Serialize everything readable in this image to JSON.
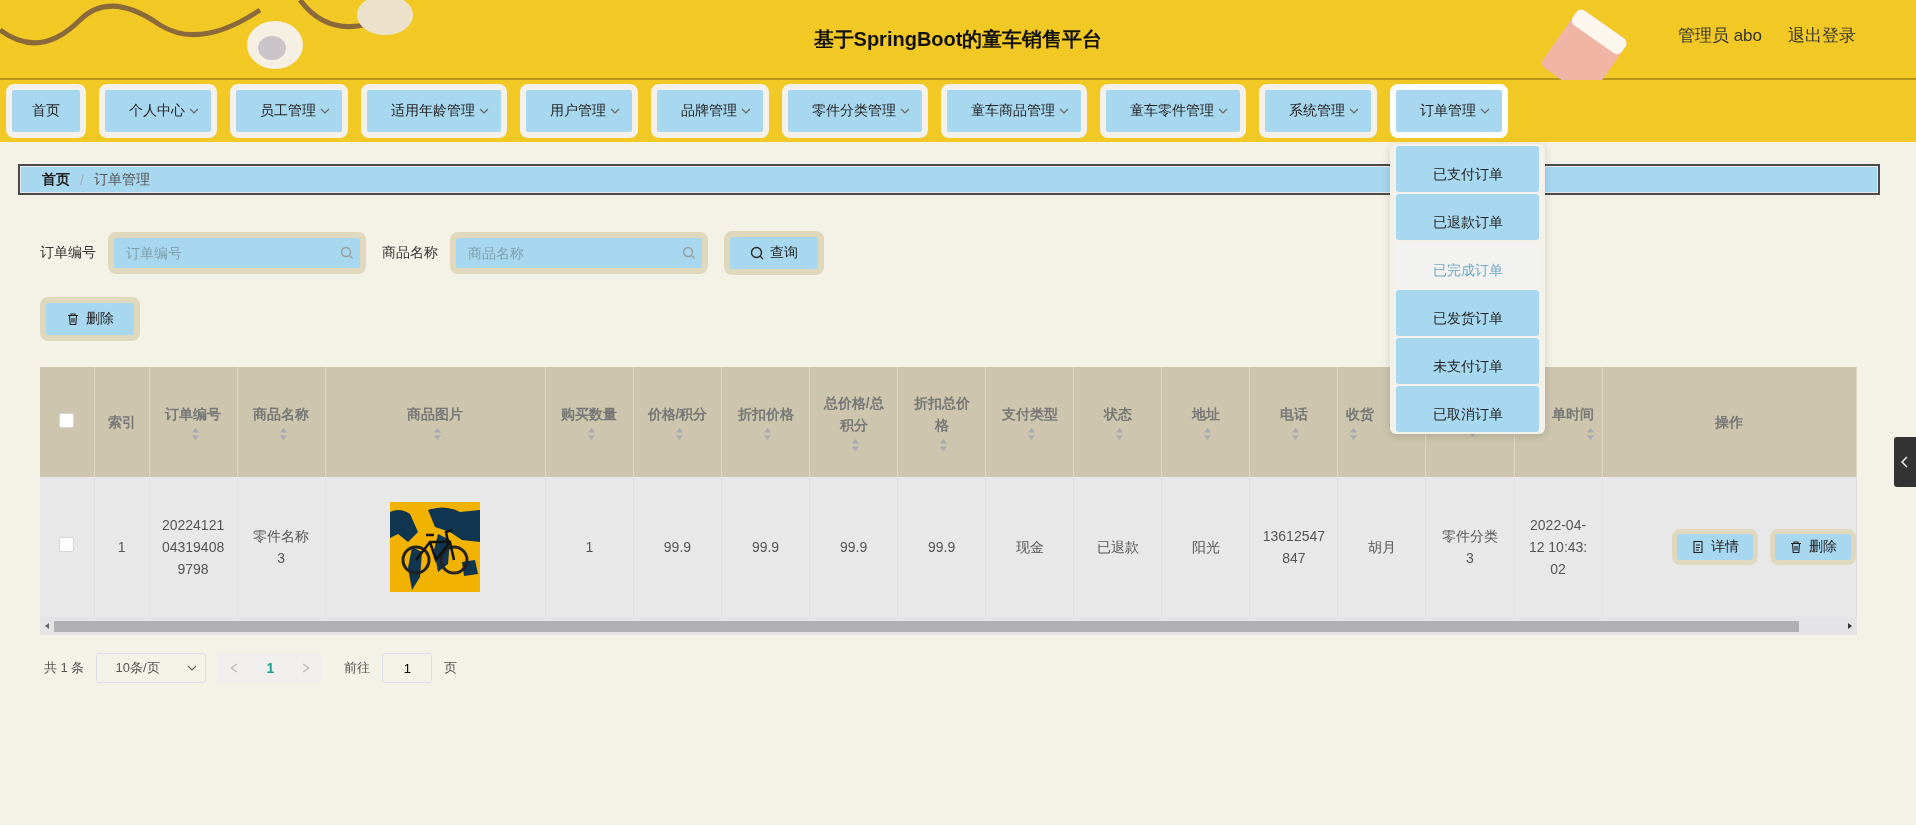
{
  "header": {
    "title": "基于SpringBoot的童车销售平台",
    "user": "管理员 abo",
    "logout": "退出登录"
  },
  "nav": [
    {
      "label": "首页",
      "has_menu": false,
      "expanded": false
    },
    {
      "label": "个人中心",
      "has_menu": true,
      "expanded": false
    },
    {
      "label": "员工管理",
      "has_menu": true,
      "expanded": false
    },
    {
      "label": "适用年龄管理",
      "has_menu": true,
      "expanded": false
    },
    {
      "label": "用户管理",
      "has_menu": true,
      "expanded": false
    },
    {
      "label": "品牌管理",
      "has_menu": true,
      "expanded": false
    },
    {
      "label": "零件分类管理",
      "has_menu": true,
      "expanded": false
    },
    {
      "label": "童车商品管理",
      "has_menu": true,
      "expanded": false
    },
    {
      "label": "童车零件管理",
      "has_menu": true,
      "expanded": false
    },
    {
      "label": "系统管理",
      "has_menu": true,
      "expanded": false
    },
    {
      "label": "订单管理",
      "has_menu": true,
      "expanded": true,
      "menu": [
        {
          "label": "已支付订单",
          "hovered": false
        },
        {
          "label": "已退款订单",
          "hovered": false
        },
        {
          "label": "已完成订单",
          "hovered": true
        },
        {
          "label": "已发货订单",
          "hovered": false
        },
        {
          "label": "未支付订单",
          "hovered": false
        },
        {
          "label": "已取消订单",
          "hovered": false
        }
      ]
    }
  ],
  "breadcrumb": {
    "separator": "/",
    "items": [
      {
        "label": "首页",
        "current": false
      },
      {
        "label": "订单管理",
        "current": true
      }
    ]
  },
  "search": {
    "fields": [
      {
        "label": "订单编号",
        "placeholder": "订单编号"
      },
      {
        "label": "商品名称",
        "placeholder": "商品名称"
      }
    ],
    "button": "查询"
  },
  "delete_button": "删除",
  "table": {
    "columns": [
      {
        "kind": "checkbox",
        "checked": false
      },
      {
        "kind": "text",
        "label": "索引",
        "sortable": false
      },
      {
        "kind": "text",
        "label": "订单编号",
        "sortable": true
      },
      {
        "kind": "text",
        "label": "商品名称",
        "sortable": true
      },
      {
        "kind": "picture",
        "label": "商品图片",
        "sortable": true
      },
      {
        "kind": "text",
        "label": "购买数量",
        "sortable": true
      },
      {
        "kind": "text",
        "label": "价格/积分",
        "sortable": true
      },
      {
        "kind": "text",
        "label": "折扣价格",
        "sortable": true
      },
      {
        "kind": "text",
        "label": "总价格/总积分",
        "sortable": true
      },
      {
        "kind": "text",
        "label": "折扣总价格",
        "sortable": true
      },
      {
        "kind": "text",
        "label": "支付类型",
        "sortable": true
      },
      {
        "kind": "text",
        "label": "状态",
        "sortable": true
      },
      {
        "kind": "text",
        "label": "地址",
        "sortable": true
      },
      {
        "kind": "text",
        "label": "电话",
        "sortable": true
      },
      {
        "kind": "text-cut-right",
        "label": "收货",
        "sortable": true
      },
      {
        "kind": "text",
        "sortable": true
      },
      {
        "kind": "text-cut-left",
        "label": "单时间",
        "sortable": true
      },
      {
        "kind": "actions",
        "label": "操作",
        "sortable": false
      }
    ],
    "rows": [
      {
        "cells": [
          {
            "kind": "checkbox",
            "checked": false
          },
          {
            "kind": "text",
            "text": "1"
          },
          {
            "kind": "text",
            "text": "20224121043194089798"
          },
          {
            "kind": "text",
            "text": "零件名称3"
          },
          {
            "kind": "picture"
          },
          {
            "kind": "text",
            "text": "1"
          },
          {
            "kind": "text",
            "text": "99.9"
          },
          {
            "kind": "text",
            "text": "99.9"
          },
          {
            "kind": "text",
            "text": "99.9"
          },
          {
            "kind": "text",
            "text": "99.9"
          },
          {
            "kind": "text",
            "text": "现金"
          },
          {
            "kind": "text",
            "text": "已退款"
          },
          {
            "kind": "text",
            "text": "阳光"
          },
          {
            "kind": "text",
            "text": "13612547847"
          },
          {
            "kind": "text",
            "text": "胡月"
          },
          {
            "kind": "text",
            "text": "零件分类3"
          },
          {
            "kind": "text",
            "text": "2022-04-12 10:43:02"
          },
          {
            "kind": "actions",
            "buttons": [
              {
                "kind": "detail",
                "label": "详情"
              },
              {
                "kind": "delete",
                "label": "删除"
              }
            ]
          }
        ]
      }
    ]
  },
  "pagination": {
    "total": "共 1 条",
    "page_size": "10条/页",
    "pages": [
      {
        "label": "1",
        "selected": true
      }
    ],
    "jump_label": "前往",
    "jump_value": "1",
    "jump_suffix": "页"
  }
}
